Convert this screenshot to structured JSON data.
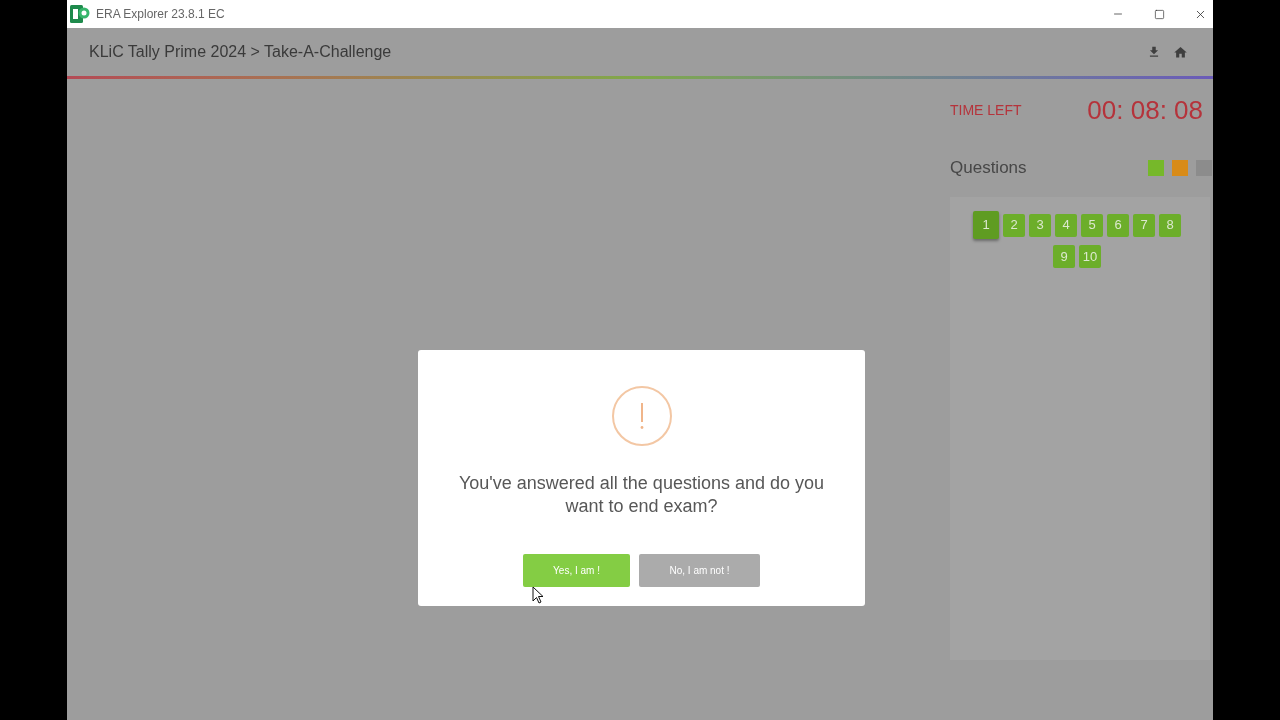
{
  "window": {
    "title": "ERA Explorer 23.8.1 EC"
  },
  "header": {
    "breadcrumb": "KLiC Tally Prime 2024 > Take-A-Challenge"
  },
  "timer": {
    "label": "TIME LEFT",
    "value": "00: 08: 08"
  },
  "questions": {
    "title": "Questions",
    "legend": [
      {
        "color": "#76b82a"
      },
      {
        "color": "#d88b18"
      },
      {
        "color": "#8c8c8c"
      }
    ],
    "items": [
      {
        "label": "1",
        "selected": true
      },
      {
        "label": "2",
        "selected": false
      },
      {
        "label": "3",
        "selected": false
      },
      {
        "label": "4",
        "selected": false
      },
      {
        "label": "5",
        "selected": false
      },
      {
        "label": "6",
        "selected": false
      },
      {
        "label": "7",
        "selected": false
      },
      {
        "label": "8",
        "selected": false
      },
      {
        "label": "9",
        "selected": false
      },
      {
        "label": "10",
        "selected": false
      }
    ]
  },
  "dialog": {
    "message": "You've answered all the questions and do you want to end exam?",
    "buttons": [
      {
        "label": "Yes, I am !",
        "kind": "confirm"
      },
      {
        "label": "No, I am not !",
        "kind": "cancel"
      }
    ]
  }
}
